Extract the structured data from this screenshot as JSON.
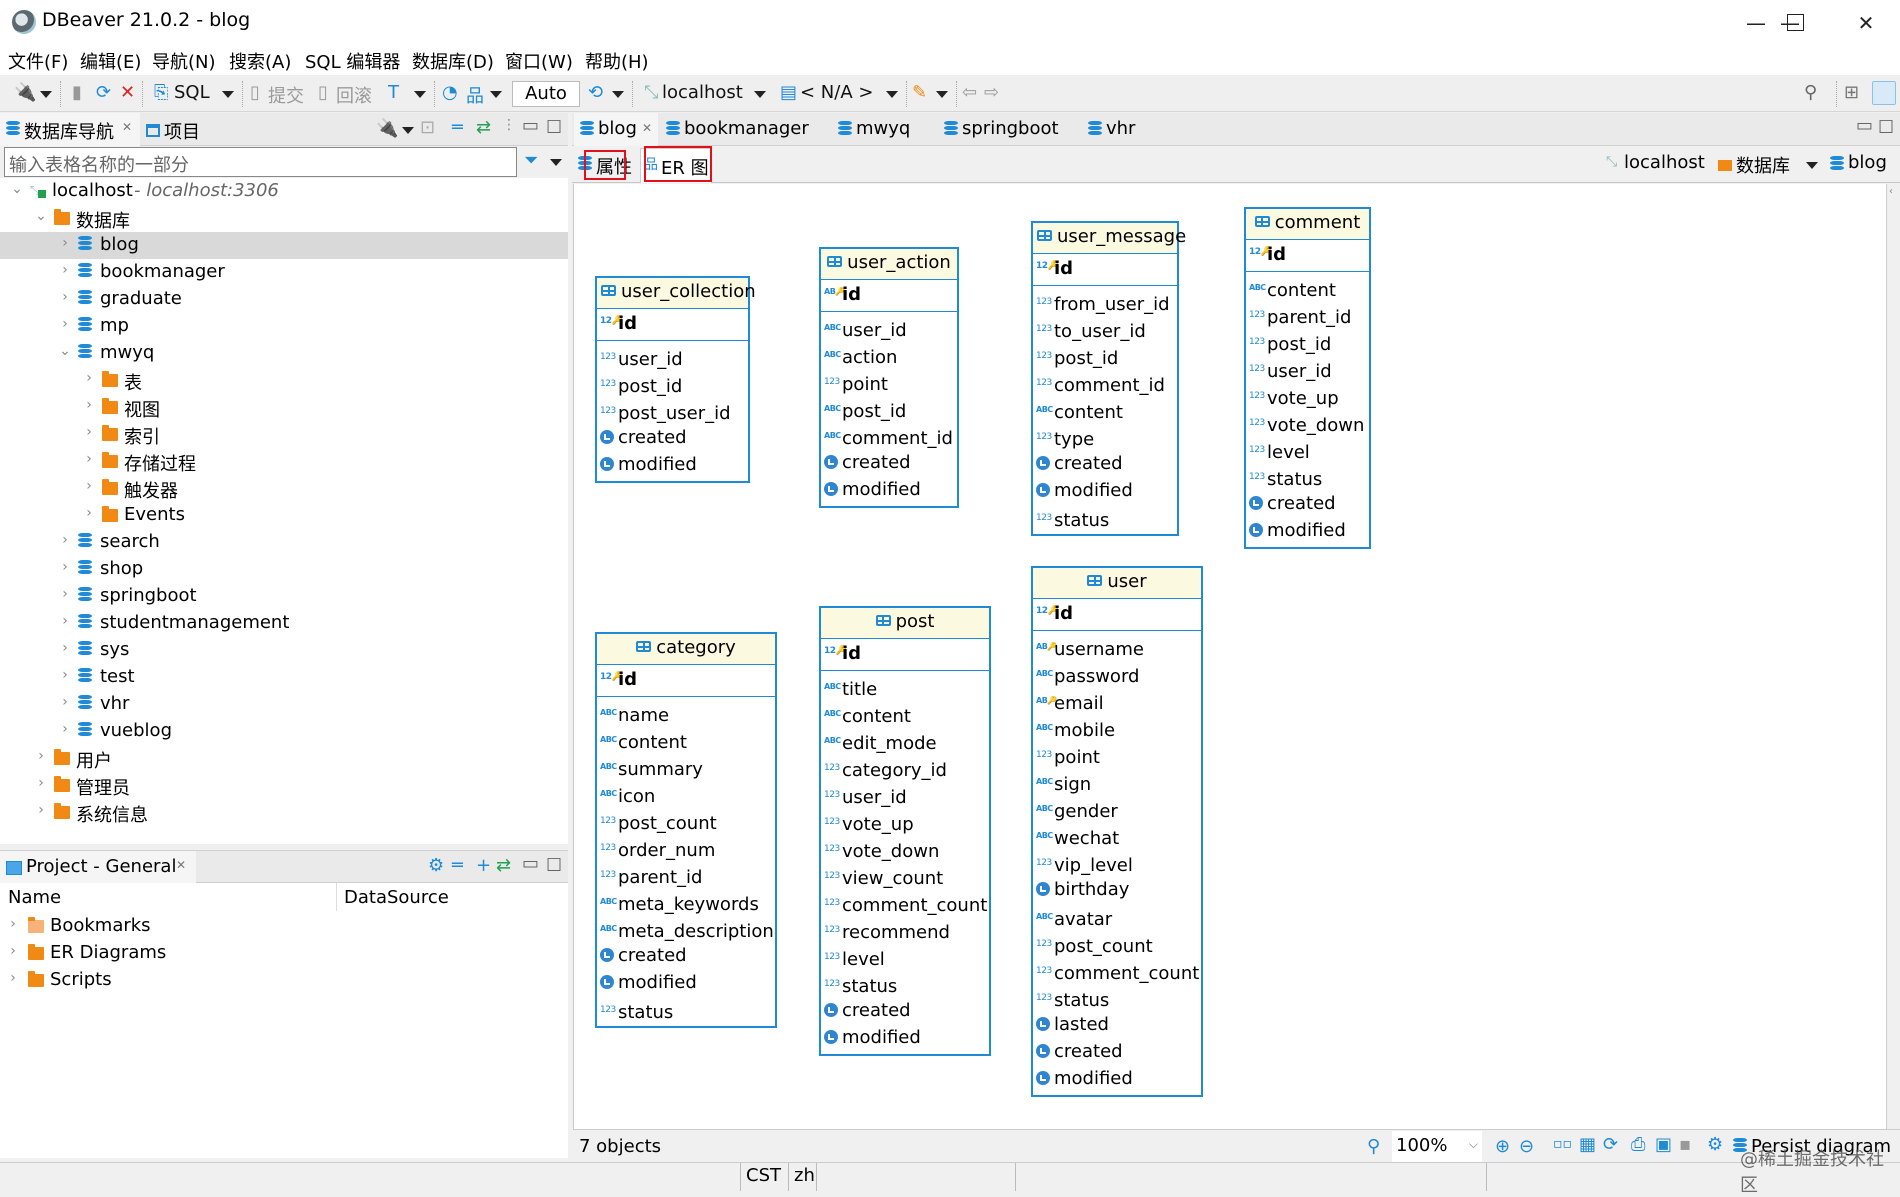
{
  "window": {
    "title": "DBeaver 21.0.2 - blog",
    "controls": {
      "minimize": "—",
      "maximize": "☐",
      "close": "✕"
    }
  },
  "menu": [
    "文件(F)",
    "编辑(E)",
    "导航(N)",
    "搜索(A)",
    "SQL 编辑器",
    "数据库(D)",
    "窗口(W)",
    "帮助(H)"
  ],
  "toolbar": {
    "sql_label": "SQL",
    "commit_label": "提交",
    "rollback_label": "回滚",
    "transaction_mode": "Auto",
    "connection": "localhost",
    "schema": "< N/A >"
  },
  "left_panel": {
    "tabs": [
      {
        "label": "数据库导航",
        "active": true
      },
      {
        "label": "项目",
        "active": false
      }
    ],
    "filter_placeholder": "输入表格名称的一部分",
    "tree": [
      {
        "level": 0,
        "expanded": true,
        "icon": "connection",
        "label": "localhost",
        "sub": " - localhost:3306"
      },
      {
        "level": 1,
        "expanded": true,
        "icon": "db-folder",
        "label": "数据库"
      },
      {
        "level": 2,
        "expanded": false,
        "icon": "database",
        "label": "blog",
        "selected": true
      },
      {
        "level": 2,
        "expanded": false,
        "icon": "database",
        "label": "bookmanager"
      },
      {
        "level": 2,
        "expanded": false,
        "icon": "database",
        "label": "graduate"
      },
      {
        "level": 2,
        "expanded": false,
        "icon": "database",
        "label": "mp"
      },
      {
        "level": 2,
        "expanded": true,
        "icon": "database",
        "label": "mwyq"
      },
      {
        "level": 3,
        "expanded": false,
        "icon": "table-folder",
        "label": "表"
      },
      {
        "level": 3,
        "expanded": false,
        "icon": "view-folder",
        "label": "视图"
      },
      {
        "level": 3,
        "expanded": false,
        "icon": "folder",
        "label": "索引"
      },
      {
        "level": 3,
        "expanded": false,
        "icon": "folder",
        "label": "存储过程"
      },
      {
        "level": 3,
        "expanded": false,
        "icon": "folder",
        "label": "触发器"
      },
      {
        "level": 3,
        "expanded": false,
        "icon": "folder",
        "label": "Events"
      },
      {
        "level": 2,
        "expanded": false,
        "icon": "database",
        "label": "search"
      },
      {
        "level": 2,
        "expanded": false,
        "icon": "database",
        "label": "shop"
      },
      {
        "level": 2,
        "expanded": false,
        "icon": "database",
        "label": "springboot"
      },
      {
        "level": 2,
        "expanded": false,
        "icon": "database",
        "label": "studentmanagement"
      },
      {
        "level": 2,
        "expanded": false,
        "icon": "database",
        "label": "sys"
      },
      {
        "level": 2,
        "expanded": false,
        "icon": "database",
        "label": "test"
      },
      {
        "level": 2,
        "expanded": false,
        "icon": "database",
        "label": "vhr"
      },
      {
        "level": 2,
        "expanded": false,
        "icon": "database",
        "label": "vueblog"
      },
      {
        "level": 1,
        "expanded": false,
        "icon": "user-folder",
        "label": "用户"
      },
      {
        "level": 1,
        "expanded": false,
        "icon": "admin-folder",
        "label": "管理员"
      },
      {
        "level": 1,
        "expanded": false,
        "icon": "info-folder",
        "label": "系统信息"
      }
    ]
  },
  "project_panel": {
    "tab_label": "Project - General",
    "columns": [
      "Name",
      "DataSource"
    ],
    "items": [
      {
        "icon": "bookmarks-folder",
        "label": "Bookmarks"
      },
      {
        "icon": "er-folder",
        "label": "ER Diagrams"
      },
      {
        "icon": "scripts-folder",
        "label": "Scripts"
      }
    ]
  },
  "editor": {
    "tabs": [
      {
        "label": "blog",
        "active": true,
        "closable": true
      },
      {
        "label": "bookmanager"
      },
      {
        "label": "mwyq"
      },
      {
        "label": "springboot"
      },
      {
        "label": "vhr"
      }
    ],
    "subtabs": [
      {
        "label": "属性",
        "active": false
      },
      {
        "label": "ER 图",
        "active": true
      }
    ],
    "breadcrumb": {
      "connection": "localhost",
      "folder": "数据库",
      "database": "blog"
    }
  },
  "er_tables": [
    {
      "name": "user_collection",
      "key": {
        "type": "num-key",
        "name": "id"
      },
      "columns": [
        {
          "type": "num",
          "name": "user_id"
        },
        {
          "type": "num",
          "name": "post_id"
        },
        {
          "type": "num",
          "name": "post_user_id"
        },
        {
          "type": "date",
          "name": "created"
        },
        {
          "type": "date",
          "name": "modified"
        }
      ]
    },
    {
      "name": "user_action",
      "key": {
        "type": "str-key",
        "name": "id"
      },
      "columns": [
        {
          "type": "str",
          "name": "user_id"
        },
        {
          "type": "str",
          "name": "action"
        },
        {
          "type": "num",
          "name": "point"
        },
        {
          "type": "str",
          "name": "post_id"
        },
        {
          "type": "str",
          "name": "comment_id"
        },
        {
          "type": "date",
          "name": "created"
        },
        {
          "type": "date",
          "name": "modified"
        }
      ]
    },
    {
      "name": "user_message",
      "key": {
        "type": "num-key",
        "name": "id"
      },
      "columns": [
        {
          "type": "num",
          "name": "from_user_id"
        },
        {
          "type": "num",
          "name": "to_user_id"
        },
        {
          "type": "num",
          "name": "post_id"
        },
        {
          "type": "num",
          "name": "comment_id"
        },
        {
          "type": "str",
          "name": "content"
        },
        {
          "type": "num",
          "name": "type"
        },
        {
          "type": "date",
          "name": "created"
        },
        {
          "type": "date",
          "name": "modified"
        },
        {
          "type": "num",
          "name": "status"
        }
      ]
    },
    {
      "name": "comment",
      "key": {
        "type": "num-key",
        "name": "id"
      },
      "columns": [
        {
          "type": "str",
          "name": "content"
        },
        {
          "type": "num",
          "name": "parent_id"
        },
        {
          "type": "num",
          "name": "post_id"
        },
        {
          "type": "num",
          "name": "user_id"
        },
        {
          "type": "num",
          "name": "vote_up"
        },
        {
          "type": "num",
          "name": "vote_down"
        },
        {
          "type": "num",
          "name": "level"
        },
        {
          "type": "num",
          "name": "status"
        },
        {
          "type": "date",
          "name": "created"
        },
        {
          "type": "date",
          "name": "modified"
        }
      ]
    },
    {
      "name": "category",
      "key": {
        "type": "num-key",
        "name": "id"
      },
      "columns": [
        {
          "type": "str",
          "name": "name"
        },
        {
          "type": "str",
          "name": "content"
        },
        {
          "type": "str",
          "name": "summary"
        },
        {
          "type": "str",
          "name": "icon"
        },
        {
          "type": "num",
          "name": "post_count"
        },
        {
          "type": "num",
          "name": "order_num"
        },
        {
          "type": "num",
          "name": "parent_id"
        },
        {
          "type": "str",
          "name": "meta_keywords"
        },
        {
          "type": "str",
          "name": "meta_description"
        },
        {
          "type": "date",
          "name": "created"
        },
        {
          "type": "date",
          "name": "modified"
        },
        {
          "type": "num",
          "name": "status"
        }
      ]
    },
    {
      "name": "post",
      "key": {
        "type": "num-key",
        "name": "id"
      },
      "columns": [
        {
          "type": "str",
          "name": "title"
        },
        {
          "type": "str",
          "name": "content"
        },
        {
          "type": "str",
          "name": "edit_mode"
        },
        {
          "type": "num",
          "name": "category_id"
        },
        {
          "type": "num",
          "name": "user_id"
        },
        {
          "type": "num",
          "name": "vote_up"
        },
        {
          "type": "num",
          "name": "vote_down"
        },
        {
          "type": "num",
          "name": "view_count"
        },
        {
          "type": "num",
          "name": "comment_count"
        },
        {
          "type": "num",
          "name": "recommend"
        },
        {
          "type": "num",
          "name": "level"
        },
        {
          "type": "num",
          "name": "status"
        },
        {
          "type": "date",
          "name": "created"
        },
        {
          "type": "date",
          "name": "modified"
        }
      ]
    },
    {
      "name": "user",
      "key": {
        "type": "num-key",
        "name": "id"
      },
      "columns": [
        {
          "type": "str-key",
          "name": "username"
        },
        {
          "type": "str",
          "name": "password"
        },
        {
          "type": "str-key",
          "name": "email"
        },
        {
          "type": "str",
          "name": "mobile"
        },
        {
          "type": "num",
          "name": "point"
        },
        {
          "type": "str",
          "name": "sign"
        },
        {
          "type": "str",
          "name": "gender"
        },
        {
          "type": "str",
          "name": "wechat"
        },
        {
          "type": "num",
          "name": "vip_level"
        },
        {
          "type": "date",
          "name": "birthday"
        },
        {
          "type": "str",
          "name": "avatar"
        },
        {
          "type": "num",
          "name": "post_count"
        },
        {
          "type": "num",
          "name": "comment_count"
        },
        {
          "type": "num",
          "name": "status"
        },
        {
          "type": "date",
          "name": "lasted"
        },
        {
          "type": "date",
          "name": "created"
        },
        {
          "type": "date",
          "name": "modified"
        }
      ]
    }
  ],
  "canvas_status": {
    "object_count": "7 objects",
    "zoom_level": "100%",
    "persist_label": "Persist diagram"
  },
  "statusbar": {
    "timezone": "CST",
    "locale": "zh"
  },
  "watermark": "@稀土掘金技术社区",
  "colors": {
    "accent": "#1f8ad6",
    "table_header_bg": "#fbf9df",
    "highlight_box": "#e2101c",
    "folder": "#f08a14"
  }
}
